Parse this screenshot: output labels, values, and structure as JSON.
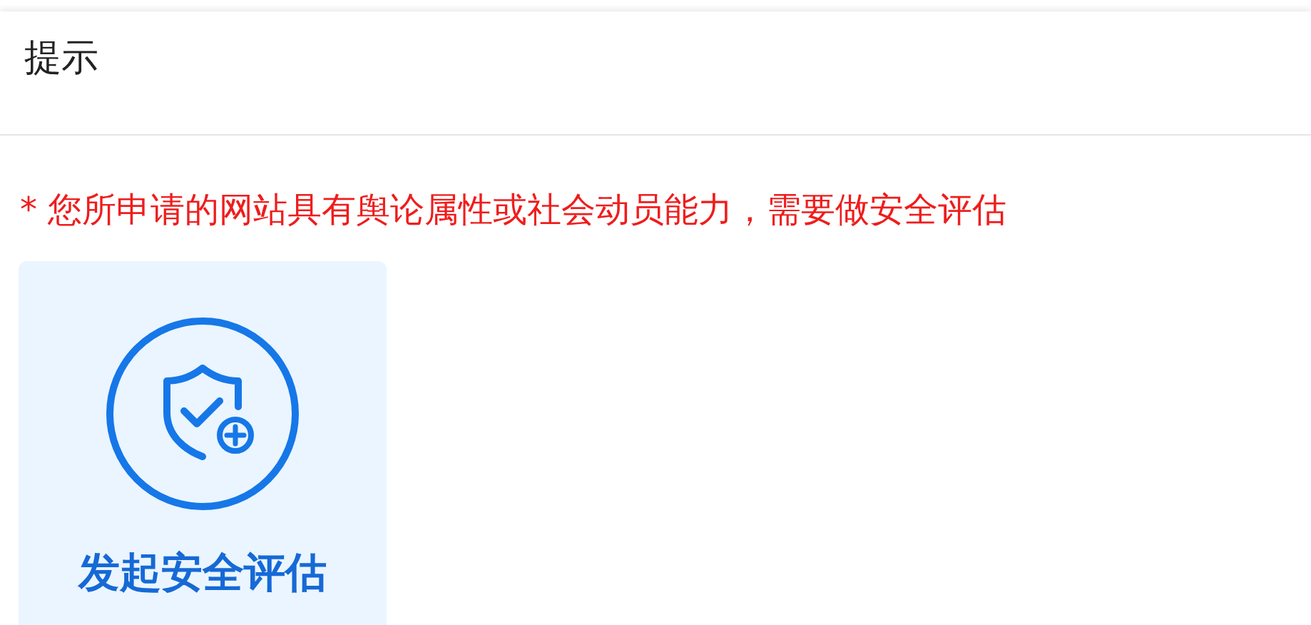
{
  "dialog": {
    "title": "提示"
  },
  "warning": "* 您所申请的网站具有舆论属性或社会动员能力，需要做安全评估",
  "actions": [
    {
      "label": "发起安全评估"
    }
  ]
}
